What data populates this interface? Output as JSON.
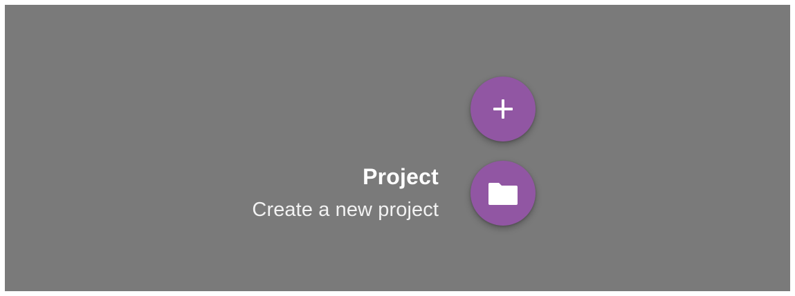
{
  "speed_dial": {
    "main_action": {
      "icon": "plus-icon",
      "color": "#9156a3"
    },
    "items": [
      {
        "title": "Project",
        "subtitle": "Create a new project",
        "icon": "folder-icon",
        "color": "#9156a3"
      }
    ]
  },
  "colors": {
    "overlay": "#7a7a7a",
    "accent": "#9156a3",
    "text": "#ffffff"
  }
}
